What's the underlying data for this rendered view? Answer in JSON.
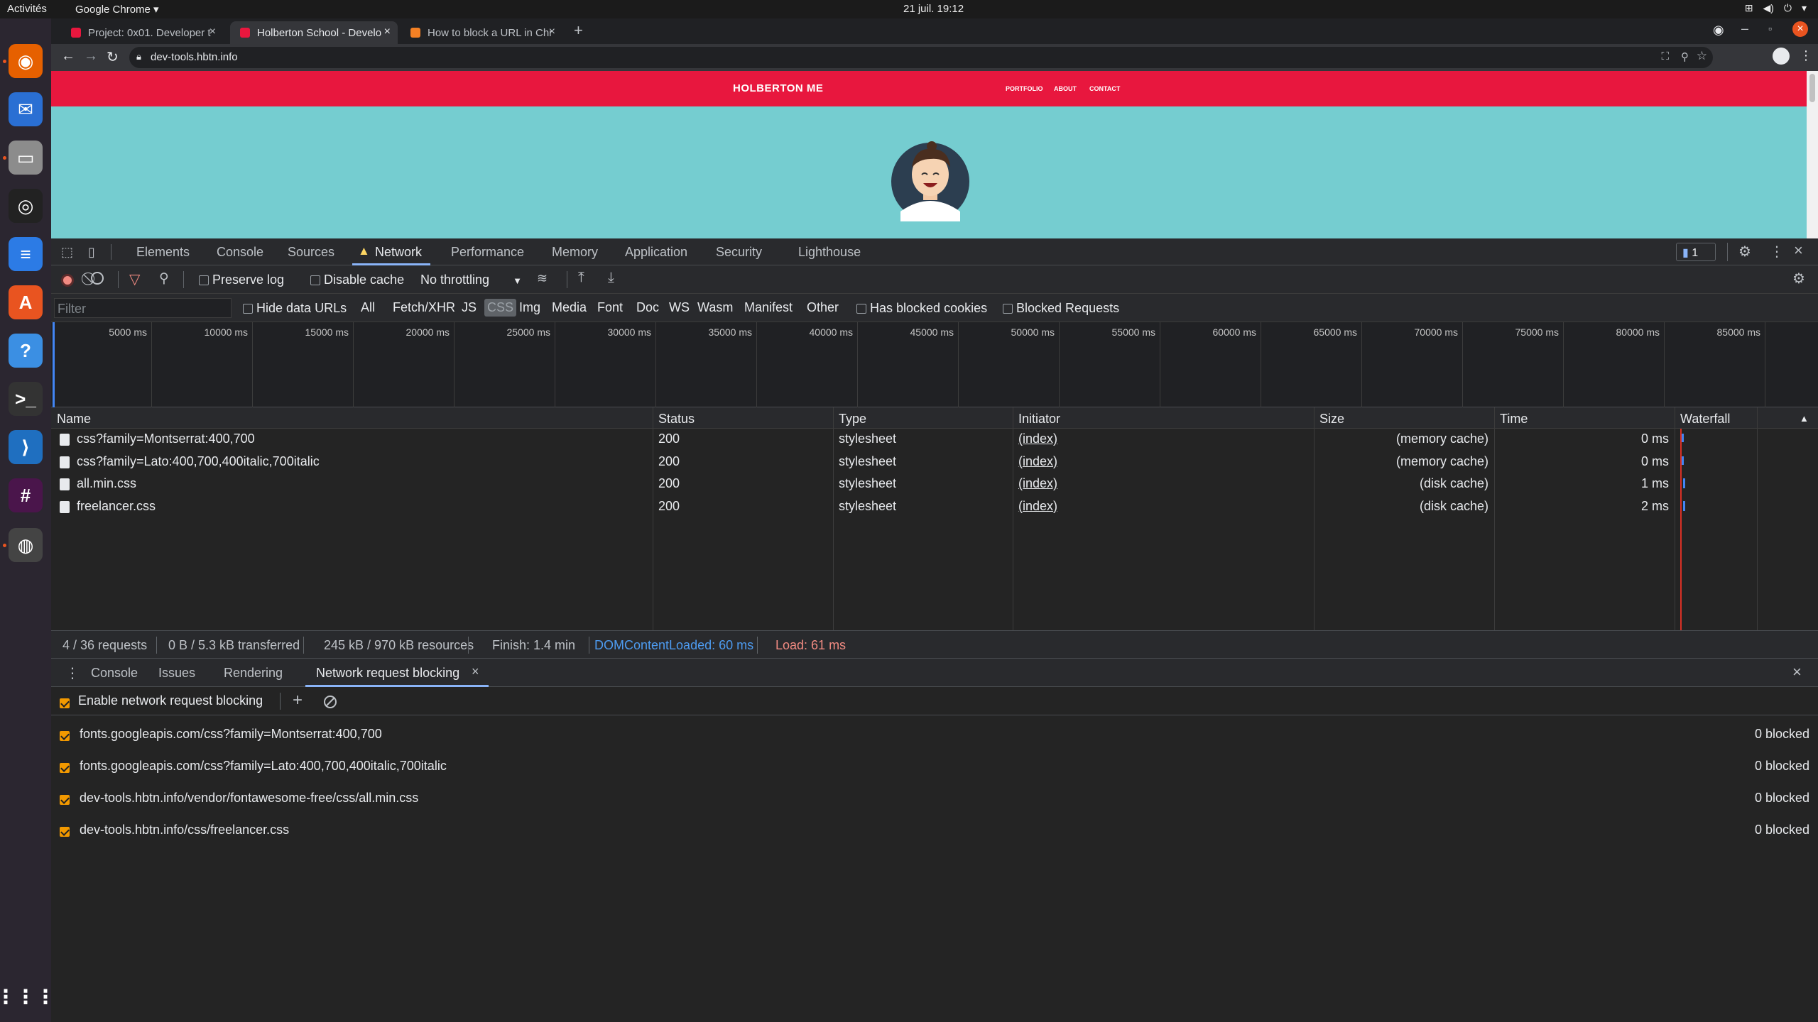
{
  "os": {
    "activities": "Activités",
    "app_name": "Google Chrome ▾",
    "clock": "21 juil.  19:12",
    "dock": [
      {
        "name": "firefox-icon",
        "color": "#e66000",
        "glyph": "◉"
      },
      {
        "name": "thunderbird-icon",
        "color": "#2a6fd3",
        "glyph": "✉"
      },
      {
        "name": "files-icon",
        "color": "#8c8c8c",
        "glyph": "▭"
      },
      {
        "name": "rhythmbox-icon",
        "color": "#222",
        "glyph": "◎"
      },
      {
        "name": "writer-icon",
        "color": "#2c7be5",
        "glyph": "≡"
      },
      {
        "name": "software-icon",
        "color": "#e95420",
        "glyph": "A"
      },
      {
        "name": "help-icon",
        "color": "#3b8fe3",
        "glyph": "?"
      },
      {
        "name": "terminal-icon",
        "color": "#333",
        "glyph": ">_"
      },
      {
        "name": "vscode-icon",
        "color": "#1f6fc0",
        "glyph": "⟩"
      },
      {
        "name": "slack-icon",
        "color": "#4a154b",
        "glyph": "#"
      },
      {
        "name": "chrome-icon",
        "color": "#444",
        "glyph": "◍"
      }
    ]
  },
  "browser": {
    "tabs": [
      {
        "title": "Project: 0x01. Developer t",
        "favicon_color": "#e8173e"
      },
      {
        "title": "Holberton School - Develo",
        "favicon_color": "#e8173e"
      },
      {
        "title": "How to block a URL in Chr",
        "favicon_color": "#f48024"
      }
    ],
    "new_tab": "+",
    "url": "dev-tools.hbtn.info"
  },
  "site": {
    "brand": "HOLBERTON ME",
    "nav": [
      "PORTFOLIO",
      "ABOUT",
      "CONTACT"
    ],
    "accent": "#e8173e",
    "hero_bg": "#75cdd0"
  },
  "devtools": {
    "panel_tabs": [
      "Elements",
      "Console",
      "Sources",
      "Network",
      "Performance",
      "Memory",
      "Application",
      "Security",
      "Lighthouse"
    ],
    "active_tab": "Network",
    "issues_count": "1",
    "toolbar": {
      "preserve_log": "Preserve log",
      "disable_cache": "Disable cache",
      "throttling": "No throttling"
    },
    "filter": {
      "placeholder": "Filter",
      "hide_data_urls": "Hide data URLs",
      "types": [
        "All",
        "Fetch/XHR",
        "JS",
        "CSS",
        "Img",
        "Media",
        "Font",
        "Doc",
        "WS",
        "Wasm",
        "Manifest",
        "Other"
      ],
      "selected_type": "CSS",
      "has_blocked_cookies": "Has blocked cookies",
      "blocked_requests": "Blocked Requests"
    },
    "timeline_ticks": [
      "5000 ms",
      "10000 ms",
      "15000 ms",
      "20000 ms",
      "25000 ms",
      "30000 ms",
      "35000 ms",
      "40000 ms",
      "45000 ms",
      "50000 ms",
      "55000 ms",
      "60000 ms",
      "65000 ms",
      "70000 ms",
      "75000 ms",
      "80000 ms",
      "85000 ms"
    ],
    "columns": [
      "Name",
      "Status",
      "Type",
      "Initiator",
      "Size",
      "Time",
      "Waterfall"
    ],
    "requests": [
      {
        "name": "css?family=Montserrat:400,700",
        "status": "200",
        "type": "stylesheet",
        "initiator": "(index)",
        "size": "(memory cache)",
        "time": "0 ms"
      },
      {
        "name": "css?family=Lato:400,700,400italic,700italic",
        "status": "200",
        "type": "stylesheet",
        "initiator": "(index)",
        "size": "(memory cache)",
        "time": "0 ms"
      },
      {
        "name": "all.min.css",
        "status": "200",
        "type": "stylesheet",
        "initiator": "(index)",
        "size": "(disk cache)",
        "time": "1 ms"
      },
      {
        "name": "freelancer.css",
        "status": "200",
        "type": "stylesheet",
        "initiator": "(index)",
        "size": "(disk cache)",
        "time": "2 ms"
      }
    ],
    "summary": {
      "requests": "4 / 36 requests",
      "transferred": "0 B / 5.3 kB transferred",
      "resources": "245 kB / 970 kB resources",
      "finish": "Finish: 1.4 min",
      "dom_content_loaded": "DOMContentLoaded: 60 ms",
      "load": "Load: 61 ms",
      "dcl_color": "#4d9bf0",
      "load_color": "#f28b82"
    },
    "drawer": {
      "tabs": [
        "Console",
        "Issues",
        "Rendering",
        "Network request blocking"
      ],
      "active_tab": "Network request blocking",
      "enable_label": "Enable network request blocking",
      "patterns": [
        {
          "pattern": "fonts.googleapis.com/css?family=Montserrat:400,700",
          "blocked": "0 blocked"
        },
        {
          "pattern": "fonts.googleapis.com/css?family=Lato:400,700,400italic,700italic",
          "blocked": "0 blocked"
        },
        {
          "pattern": "dev-tools.hbtn.info/vendor/fontawesome-free/css/all.min.css",
          "blocked": "0 blocked"
        },
        {
          "pattern": "dev-tools.hbtn.info/css/freelancer.css",
          "blocked": "0 blocked"
        }
      ]
    }
  }
}
